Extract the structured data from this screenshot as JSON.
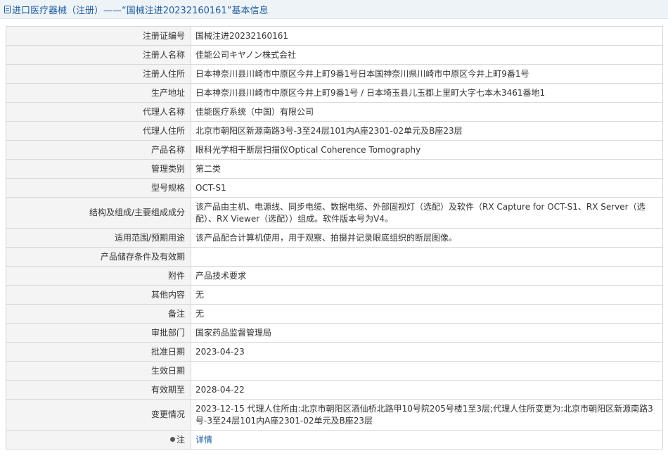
{
  "page_title": "进口医疗器械（注册）——“国械注进20232160161”基本信息",
  "rows": [
    {
      "label": "注册证编号",
      "value": "国械注进20232160161"
    },
    {
      "label": "注册人名称",
      "value": "佳能公司キヤノン株式会社"
    },
    {
      "label": "注册人住所",
      "value": "日本神奈川县川崎市中原区今井上町9番1号日本国神奈川県川崎市中原区今井上町9番1号"
    },
    {
      "label": "生产地址",
      "value": "日本神奈川县川崎市中原区今井上町9番1号 / 日本埼玉县儿玉郡上里町大字七本木3461番地1"
    },
    {
      "label": "代理人名称",
      "value": "佳能医疗系统（中国）有限公司"
    },
    {
      "label": "代理人住所",
      "value": "北京市朝阳区新源南路3号-3至24层101内A座2301-02单元及B座23层"
    },
    {
      "label": "产品名称",
      "value": "眼科光学相干断层扫描仪Optical Coherence Tomography"
    },
    {
      "label": "管理类别",
      "value": "第二类"
    },
    {
      "label": "型号规格",
      "value": "OCT-S1"
    },
    {
      "label": "结构及组成/主要组成成分",
      "value": "该产品由主机、电源线、同步电缆、数据电缆、外部固视灯（选配）及软件（RX Capture for OCT-S1、RX Server（选配）、RX Viewer（选配））组成。软件版本号为V4。",
      "tall": true
    },
    {
      "label": "适用范围/预期用途",
      "value": "该产品配合计算机使用，用于观察、拍摄并记录眼底组织的断层图像。"
    },
    {
      "label": "产品储存条件及有效期",
      "value": ""
    },
    {
      "label": "附件",
      "value": "产品技术要求"
    },
    {
      "label": "其他内容",
      "value": "无"
    },
    {
      "label": "备注",
      "value": "无"
    },
    {
      "label": "审批部门",
      "value": "国家药品监督管理局"
    },
    {
      "label": "批准日期",
      "value": "2023-04-23"
    },
    {
      "label": "生效日期",
      "value": ""
    },
    {
      "label": "有效期至",
      "value": "2028-04-22"
    },
    {
      "label": "变更情况",
      "value": "2023-12-15 代理人住所由:北京市朝阳区酒仙桥北路甲10号院205号楼1至3层;代理人住所变更为:北京市朝阳区新源南路3号-3至24层101内A座2301-02单元及B座23层",
      "tall": true
    }
  ],
  "note_row": {
    "label": "注",
    "link_text": "详情"
  },
  "colors": {
    "title_text": "#1f5d9c",
    "title_bg": "#eef3f8",
    "label_bg": "#f4f4f4",
    "border": "#d9d9d9",
    "link": "#1f5d9c"
  }
}
